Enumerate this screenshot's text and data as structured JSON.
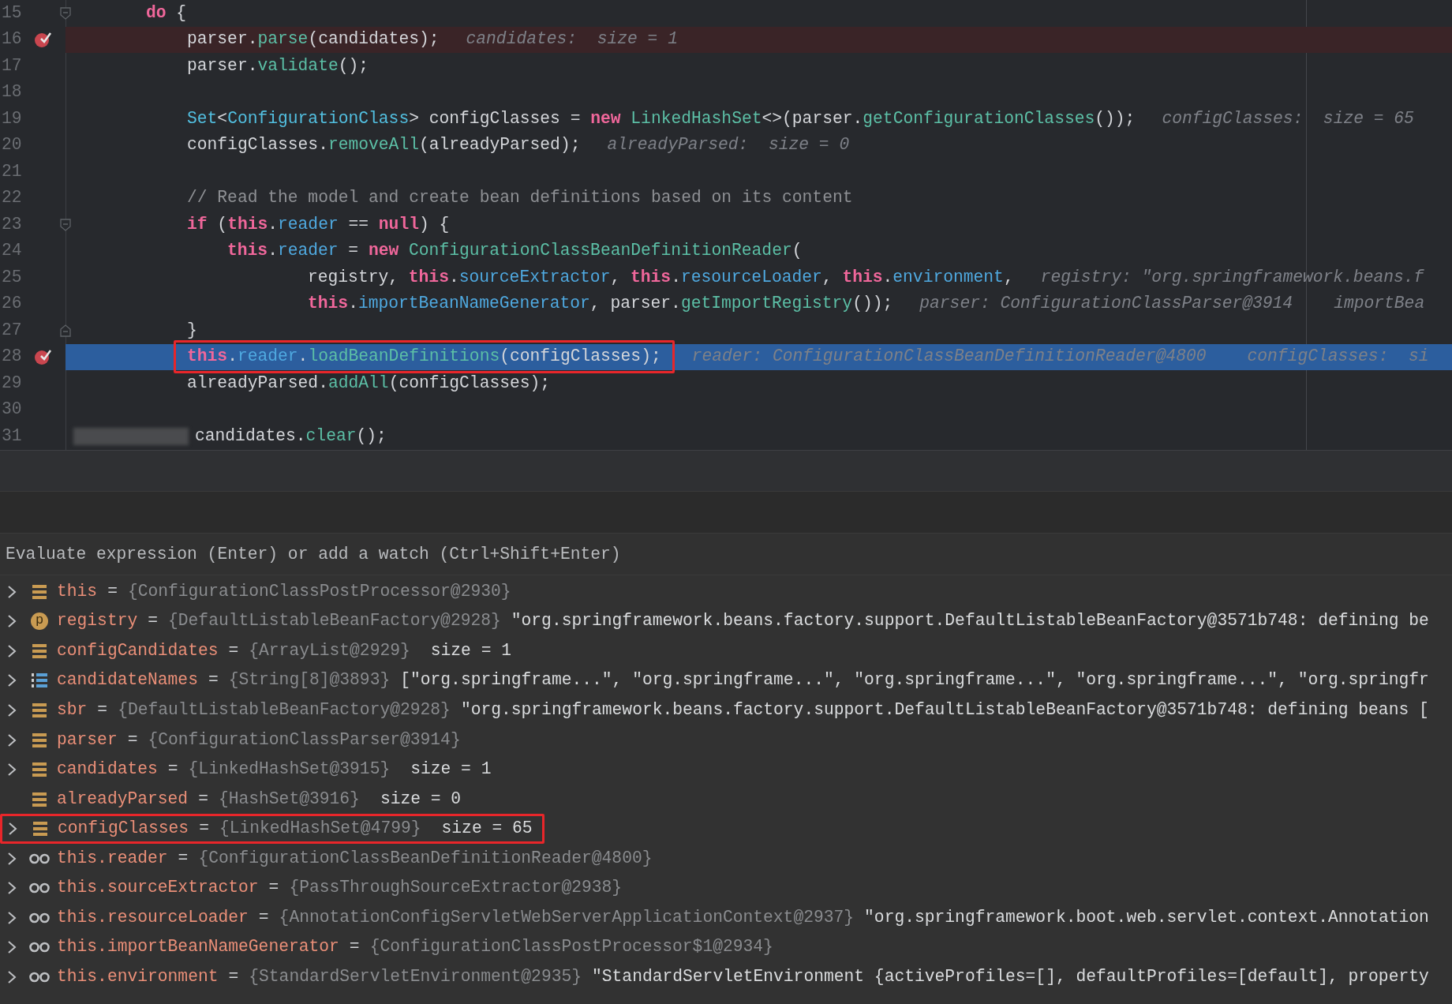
{
  "editor": {
    "lines": [
      {
        "number": "15",
        "kind": "outer",
        "tokens": [
          {
            "text": "do",
            "kind": "kw"
          },
          {
            "text": " {",
            "kind": "p"
          }
        ],
        "fold_open": true,
        "fold_close": false,
        "current": false,
        "breakpoint": false,
        "boxed": false,
        "redacted": false
      },
      {
        "number": "16",
        "kind": "body",
        "tokens": [
          {
            "text": "parser.",
            "kind": "p"
          },
          {
            "text": "parse",
            "kind": "m"
          },
          {
            "text": "(candidates);",
            "kind": "p"
          }
        ],
        "hints": [
          "candidates:  size = 1"
        ],
        "fold_open": false,
        "fold_close": false,
        "current": false,
        "breakpoint": true,
        "boxed": false,
        "redacted": false
      },
      {
        "number": "17",
        "kind": "body",
        "tokens": [
          {
            "text": "parser.",
            "kind": "p"
          },
          {
            "text": "validate",
            "kind": "m"
          },
          {
            "text": "();",
            "kind": "p"
          }
        ],
        "fold_open": false,
        "fold_close": false,
        "current": false,
        "breakpoint": false,
        "boxed": false,
        "redacted": false
      },
      {
        "number": "18",
        "fold_open": false,
        "fold_close": false,
        "current": false,
        "breakpoint": false,
        "boxed": false,
        "redacted": false
      },
      {
        "number": "19",
        "kind": "body",
        "tokens": [
          {
            "text": "Set",
            "kind": "t"
          },
          {
            "text": "<",
            "kind": "p"
          },
          {
            "text": "ConfigurationClass",
            "kind": "t"
          },
          {
            "text": "> configClasses = ",
            "kind": "p"
          },
          {
            "text": "new ",
            "kind": "kw"
          },
          {
            "text": "LinkedHashSet",
            "kind": "t2"
          },
          {
            "text": "<>(parser.",
            "kind": "p"
          },
          {
            "text": "getConfigurationClasses",
            "kind": "m"
          },
          {
            "text": "());",
            "kind": "p"
          }
        ],
        "hints": [
          "configClasses:  size = 65"
        ],
        "fold_open": false,
        "fold_close": false,
        "current": false,
        "breakpoint": false,
        "boxed": false,
        "redacted": false
      },
      {
        "number": "20",
        "kind": "body",
        "tokens": [
          {
            "text": "configClasses.",
            "kind": "p"
          },
          {
            "text": "removeAll",
            "kind": "m"
          },
          {
            "text": "(alreadyParsed);",
            "kind": "p"
          }
        ],
        "hints": [
          "alreadyParsed:  size = 0"
        ],
        "fold_open": false,
        "fold_close": false,
        "current": false,
        "breakpoint": false,
        "boxed": false,
        "redacted": false
      },
      {
        "number": "21",
        "fold_open": false,
        "fold_close": false,
        "current": false,
        "breakpoint": false,
        "boxed": false,
        "redacted": false
      },
      {
        "number": "22",
        "kind": "body",
        "tokens": [
          {
            "text": "// Read the model and create bean definitions based on its content",
            "kind": "c"
          }
        ],
        "fold_open": false,
        "fold_close": false,
        "current": false,
        "breakpoint": false,
        "boxed": false,
        "redacted": false
      },
      {
        "number": "23",
        "kind": "body",
        "tokens": [
          {
            "text": "if",
            "kind": "kw"
          },
          {
            "text": " (",
            "kind": "p"
          },
          {
            "text": "this",
            "kind": "kw"
          },
          {
            "text": ".",
            "kind": "p"
          },
          {
            "text": "reader",
            "kind": "f"
          },
          {
            "text": " == ",
            "kind": "p"
          },
          {
            "text": "null",
            "kind": "kw"
          },
          {
            "text": ") {",
            "kind": "p"
          }
        ],
        "fold_open": true,
        "fold_close": false,
        "current": false,
        "breakpoint": false,
        "boxed": false,
        "redacted": false
      },
      {
        "number": "24",
        "kind": "inner",
        "tokens": [
          {
            "text": "this",
            "kind": "kw"
          },
          {
            "text": ".",
            "kind": "p"
          },
          {
            "text": "reader",
            "kind": "f"
          },
          {
            "text": " = ",
            "kind": "p"
          },
          {
            "text": "new ",
            "kind": "kw"
          },
          {
            "text": "ConfigurationClassBeanDefinitionReader",
            "kind": "t2"
          },
          {
            "text": "(",
            "kind": "p"
          }
        ],
        "fold_open": false,
        "fold_close": false,
        "current": false,
        "breakpoint": false,
        "boxed": false,
        "redacted": false
      },
      {
        "number": "25",
        "kind": "continuation",
        "tokens": [
          {
            "text": "registry, ",
            "kind": "p"
          },
          {
            "text": "this",
            "kind": "kw"
          },
          {
            "text": ".",
            "kind": "p"
          },
          {
            "text": "sourceExtractor",
            "kind": "f"
          },
          {
            "text": ", ",
            "kind": "p"
          },
          {
            "text": "this",
            "kind": "kw"
          },
          {
            "text": ".",
            "kind": "p"
          },
          {
            "text": "resourceLoader",
            "kind": "f"
          },
          {
            "text": ", ",
            "kind": "p"
          },
          {
            "text": "this",
            "kind": "kw"
          },
          {
            "text": ".",
            "kind": "p"
          },
          {
            "text": "environment",
            "kind": "f"
          },
          {
            "text": ",",
            "kind": "p"
          }
        ],
        "hints": [
          "registry: \"org.springframework.beans.f"
        ],
        "fold_open": false,
        "fold_close": false,
        "current": false,
        "breakpoint": false,
        "boxed": false,
        "redacted": false
      },
      {
        "number": "26",
        "kind": "continuation",
        "tokens": [
          {
            "text": "this",
            "kind": "kw"
          },
          {
            "text": ".",
            "kind": "p"
          },
          {
            "text": "importBeanNameGenerator",
            "kind": "f"
          },
          {
            "text": ", parser.",
            "kind": "p"
          },
          {
            "text": "getImportRegistry",
            "kind": "m"
          },
          {
            "text": "());",
            "kind": "p"
          }
        ],
        "hints": [
          "parser: ConfigurationClassParser@3914",
          "importBea"
        ],
        "fold_open": false,
        "fold_close": false,
        "current": false,
        "breakpoint": false,
        "boxed": false,
        "redacted": false
      },
      {
        "number": "27",
        "kind": "body",
        "tokens": [
          {
            "text": "}",
            "kind": "p"
          }
        ],
        "fold_open": false,
        "fold_close": true,
        "current": false,
        "breakpoint": false,
        "boxed": false,
        "redacted": false
      },
      {
        "number": "28",
        "kind": "body",
        "tokens": [
          {
            "text": "this",
            "kind": "kw"
          },
          {
            "text": ".",
            "kind": "p"
          },
          {
            "text": "reader",
            "kind": "f"
          },
          {
            "text": ".",
            "kind": "p"
          },
          {
            "text": "loadBeanDefinitions",
            "kind": "m"
          },
          {
            "text": "(configClasses);",
            "kind": "p"
          }
        ],
        "hints": [
          "reader: ConfigurationClassBeanDefinitionReader@4800",
          "configClasses:  si"
        ],
        "fold_open": false,
        "fold_close": false,
        "current": true,
        "breakpoint": true,
        "boxed": true,
        "redacted": false
      },
      {
        "number": "29",
        "kind": "body",
        "tokens": [
          {
            "text": "alreadyParsed.",
            "kind": "p"
          },
          {
            "text": "addAll",
            "kind": "m"
          },
          {
            "text": "(configClasses);",
            "kind": "p"
          }
        ],
        "fold_open": false,
        "fold_close": false,
        "current": false,
        "breakpoint": false,
        "boxed": false,
        "redacted": false
      },
      {
        "number": "30",
        "fold_open": false,
        "fold_close": false,
        "current": false,
        "breakpoint": false,
        "boxed": false,
        "redacted": false
      },
      {
        "number": "31",
        "kind": "body",
        "tokens": [
          {
            "text": "candidates.",
            "kind": "p"
          },
          {
            "text": "clear",
            "kind": "m"
          },
          {
            "text": "();",
            "kind": "p"
          }
        ],
        "fold_open": false,
        "fold_close": false,
        "current": false,
        "breakpoint": false,
        "boxed": false,
        "redacted": true
      }
    ]
  },
  "debugger": {
    "evaluate": {
      "placeholder": "Evaluate expression (Enter) or add a watch (Ctrl+Shift+Enter)"
    },
    "variables": [
      {
        "kind": "field",
        "name": "this",
        "equals": "=",
        "type": "{ConfigurationClassPostProcessor@2930}",
        "expandable": true,
        "boxed": false
      },
      {
        "kind": "param",
        "badge": "p",
        "name": "registry",
        "equals": "=",
        "type": "{DefaultListableBeanFactory@2928}",
        "value": "\"org.springframework.beans.factory.support.DefaultListableBeanFactory@3571b748: defining be",
        "expandable": true,
        "boxed": false
      },
      {
        "kind": "field",
        "name": "configCandidates",
        "equals": "=",
        "type": "{ArrayList@2929}",
        "value": "size = 1",
        "expandable": true,
        "boxed": false
      },
      {
        "kind": "array",
        "name": "candidateNames",
        "equals": "=",
        "type": "{String[8]@3893}",
        "value": "[\"org.springframe...\", \"org.springframe...\", \"org.springframe...\", \"org.springframe...\", \"org.springfr",
        "expandable": true,
        "boxed": false
      },
      {
        "kind": "field",
        "name": "sbr",
        "equals": "=",
        "type": "{DefaultListableBeanFactory@2928}",
        "value": "\"org.springframework.beans.factory.support.DefaultListableBeanFactory@3571b748: defining beans [",
        "expandable": true,
        "boxed": false
      },
      {
        "kind": "field",
        "name": "parser",
        "equals": "=",
        "type": "{ConfigurationClassParser@3914}",
        "expandable": true,
        "boxed": false
      },
      {
        "kind": "field",
        "name": "candidates",
        "equals": "=",
        "type": "{LinkedHashSet@3915}",
        "value": "size = 1",
        "expandable": true,
        "boxed": false
      },
      {
        "kind": "field",
        "name": "alreadyParsed",
        "equals": "=",
        "type": "{HashSet@3916}",
        "value": "size = 0",
        "expandable": false,
        "boxed": false
      },
      {
        "kind": "field",
        "name": "configClasses",
        "equals": "=",
        "type": "{LinkedHashSet@4799}",
        "value": "size = 65",
        "expandable": true,
        "boxed": true
      },
      {
        "kind": "watch",
        "name": "this.reader",
        "equals": "=",
        "type": "{ConfigurationClassBeanDefinitionReader@4800}",
        "expandable": true,
        "boxed": false
      },
      {
        "kind": "watch",
        "name": "this.sourceExtractor",
        "equals": "=",
        "type": "{PassThroughSourceExtractor@2938}",
        "expandable": true,
        "boxed": false
      },
      {
        "kind": "watch",
        "name": "this.resourceLoader",
        "equals": "=",
        "type": "{AnnotationConfigServletWebServerApplicationContext@2937}",
        "value": "\"org.springframework.boot.web.servlet.context.Annotation",
        "expandable": true,
        "boxed": false
      },
      {
        "kind": "watch",
        "name": "this.importBeanNameGenerator",
        "equals": "=",
        "type": "{ConfigurationClassPostProcessor$1@2934}",
        "expandable": true,
        "boxed": false
      },
      {
        "kind": "watch",
        "name": "this.environment",
        "equals": "=",
        "type": "{StandardServletEnvironment@2935}",
        "value": "\"StandardServletEnvironment {activeProfiles=[], defaultProfiles=[default], property",
        "expandable": true,
        "boxed": false
      }
    ]
  }
}
